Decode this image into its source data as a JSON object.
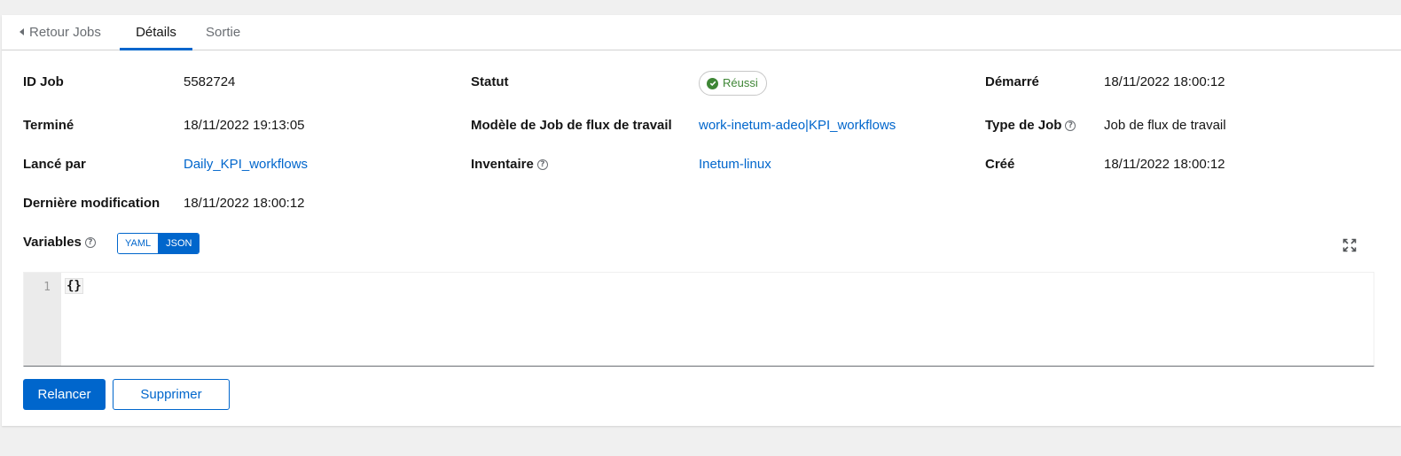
{
  "tabs": {
    "back": "Retour Jobs",
    "details": "Détails",
    "output": "Sortie"
  },
  "details": {
    "job_id": {
      "label": "ID Job",
      "value": "5582724"
    },
    "status": {
      "label": "Statut",
      "value": "Réussi"
    },
    "started": {
      "label": "Démarré",
      "value": "18/11/2022 18:00:12"
    },
    "finished": {
      "label": "Terminé",
      "value": "18/11/2022 19:13:05"
    },
    "workflow_template": {
      "label": "Modèle de Job de flux de travail",
      "value": "work-inetum-adeo|KPI_workflows"
    },
    "job_type": {
      "label": "Type de Job",
      "value": "Job de flux de travail"
    },
    "launched_by": {
      "label": "Lancé par",
      "value": "Daily_KPI_workflows"
    },
    "inventory": {
      "label": "Inventaire",
      "value": "Inetum-linux"
    },
    "created": {
      "label": "Créé",
      "value": "18/11/2022 18:00:12"
    },
    "last_modified": {
      "label": "Dernière modification",
      "value": "18/11/2022 18:00:12"
    }
  },
  "variables": {
    "label": "Variables",
    "modes": [
      "YAML",
      "JSON"
    ],
    "selected_mode": "JSON",
    "line_number": "1",
    "content": "{}"
  },
  "actions": {
    "relaunch": "Relancer",
    "delete": "Supprimer"
  },
  "colors": {
    "primary": "#0066cc",
    "success": "#3e8635",
    "text": "#151515",
    "muted": "#6a6e73"
  },
  "icons": {
    "back": "caret-left-icon",
    "help": "question-circle-icon",
    "status": "check-circle-icon",
    "expand": "expand-icon"
  }
}
